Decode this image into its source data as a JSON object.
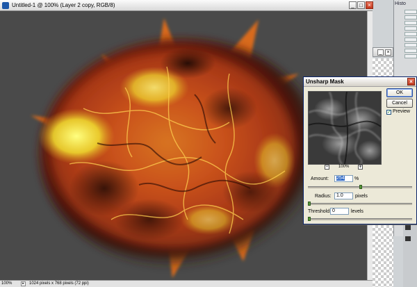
{
  "document": {
    "title": "Untitled-1 @ 100% (Layer 2 copy, RGB/8)",
    "status_zoom": "100%",
    "status_info": "1024 pixels x 768 pixels (72 ppi)",
    "canvas_color": "#4a4a4a"
  },
  "history_panel": {
    "title": "Histo"
  },
  "dialog": {
    "title": "Unsharp Mask",
    "ok_label": "OK",
    "cancel_label": "Cancel",
    "preview_label": "Preview",
    "preview_checked": true,
    "zoom_minus": "−",
    "zoom_plus": "+",
    "zoom_value": "100%",
    "amount": {
      "label": "Amount:",
      "value": "254",
      "unit": "%",
      "slider_fraction": 0.51
    },
    "radius": {
      "label": "Radius:",
      "value": "1.0",
      "unit": "pixels",
      "slider_fraction": 0.0
    },
    "threshold": {
      "label": "Threshold:",
      "value": "0",
      "unit": "levels",
      "slider_fraction": 0.0
    }
  },
  "icons": [
    "app-icon",
    "minimize-icon",
    "maximize-icon",
    "close-icon",
    "checkbox-check-icon"
  ]
}
